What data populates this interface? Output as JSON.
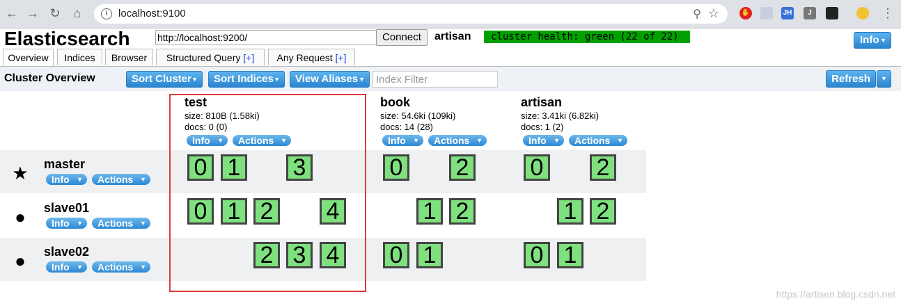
{
  "browser": {
    "url": "localhost:9100"
  },
  "header": {
    "title": "Elasticsearch",
    "connect_url": "http://localhost:9200/",
    "connect_label": "Connect",
    "cluster_name": "artisan",
    "health": "cluster health: green (22 of 22)",
    "info_label": "Info"
  },
  "tabs": [
    {
      "label": "Overview"
    },
    {
      "label": "Indices"
    },
    {
      "label": "Browser"
    },
    {
      "label": "Structured Query",
      "plus": "[+]"
    },
    {
      "label": "Any Request",
      "plus": "[+]"
    }
  ],
  "toolbar": {
    "title": "Cluster Overview",
    "sort_cluster": "Sort Cluster",
    "sort_indices": "Sort Indices",
    "view_aliases": "View Aliases",
    "filter_placeholder": "Index Filter",
    "refresh": "Refresh"
  },
  "indices": [
    {
      "name": "test",
      "size": "size: 810B (1.58ki)",
      "docs": "docs: 0 (0)",
      "info": "Info",
      "actions": "Actions"
    },
    {
      "name": "book",
      "size": "size: 54.6ki (109ki)",
      "docs": "docs: 14 (28)",
      "info": "Info",
      "actions": "Actions"
    },
    {
      "name": "artisan",
      "size": "size: 3.41ki (6.82ki)",
      "docs": "docs: 1 (2)",
      "info": "Info",
      "actions": "Actions"
    }
  ],
  "nodes": [
    {
      "name": "master",
      "info": "Info",
      "actions": "Actions",
      "shards": {
        "test": [
          "0",
          "1",
          "3"
        ],
        "book": [
          "0",
          "2"
        ],
        "artisan": [
          "0",
          "2"
        ]
      }
    },
    {
      "name": "slave01",
      "info": "Info",
      "actions": "Actions",
      "shards": {
        "test": [
          "0",
          "1",
          "2",
          "4"
        ],
        "book": [
          "1",
          "2"
        ],
        "artisan": [
          "1",
          "2"
        ]
      }
    },
    {
      "name": "slave02",
      "info": "Info",
      "actions": "Actions",
      "shards": {
        "test": [
          "2",
          "3",
          "4"
        ],
        "book": [
          "0",
          "1"
        ],
        "artisan": [
          "0",
          "1"
        ]
      }
    }
  ],
  "watermark": "https://artisen.blog.csdn.net",
  "colors": {
    "health_green": "#00a000",
    "shard_green": "#7ee07e",
    "highlight_red": "#e03a3a"
  }
}
